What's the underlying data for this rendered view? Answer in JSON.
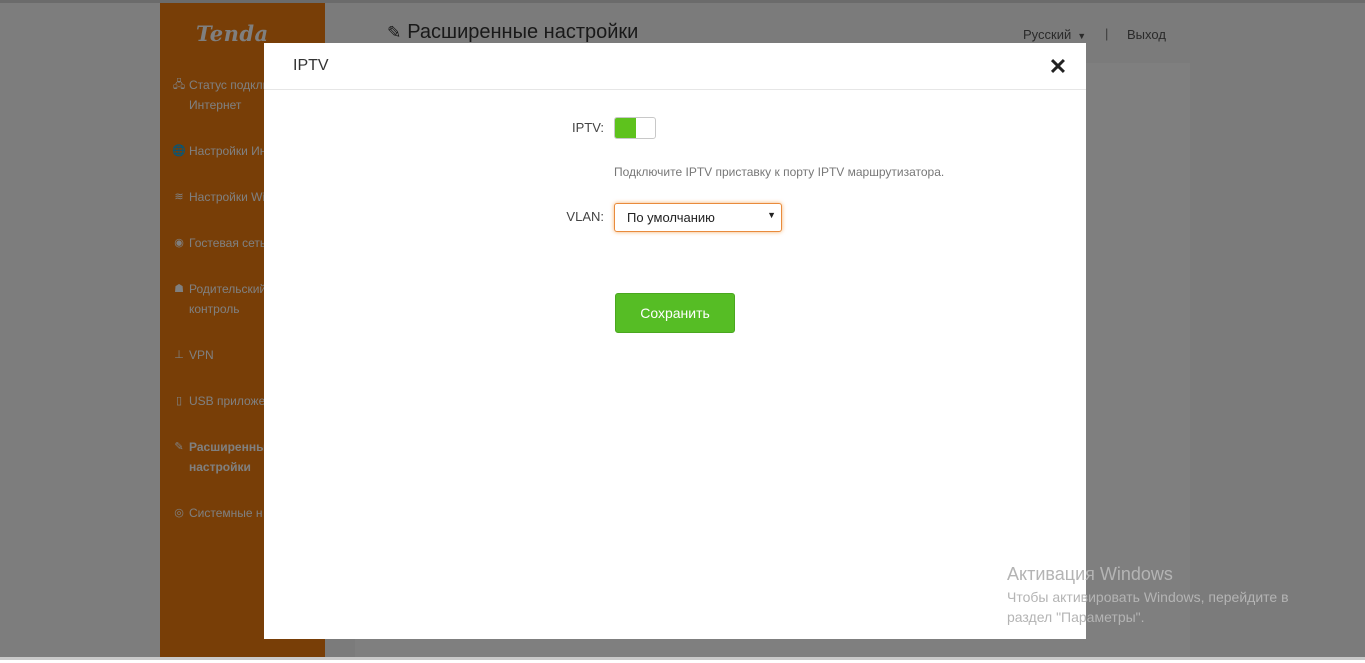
{
  "brand": {
    "logo": "Tenda",
    "accent": "#f07d0f"
  },
  "sidebar": {
    "items": [
      {
        "icon": "globe-plug-icon",
        "glyph": "🖧",
        "label": "Статус подклю",
        "label2": "Интернет"
      },
      {
        "icon": "globe-icon",
        "glyph": "🌐",
        "label": "Настройки Ин"
      },
      {
        "icon": "wifi-icon",
        "glyph": "≋",
        "label": "Настройки Wi"
      },
      {
        "icon": "guest-network-icon",
        "glyph": "◉",
        "label": "Гостевая сеть"
      },
      {
        "icon": "parental-control-icon",
        "glyph": "☗",
        "label": "Родительский",
        "label2": "контроль"
      },
      {
        "icon": "vpn-icon",
        "glyph": "⊥",
        "label": "VPN"
      },
      {
        "icon": "usb-icon",
        "glyph": "▯",
        "label": "USB приложе"
      },
      {
        "icon": "wrench-icon",
        "glyph": "✎",
        "label": "Расширенны",
        "label2": "настройки",
        "active": true
      },
      {
        "icon": "system-settings-icon",
        "glyph": "◎",
        "label": "Системные н"
      }
    ]
  },
  "header": {
    "title": "Расширенные настройки",
    "language": "Русский",
    "separator": "|",
    "logout": "Выход"
  },
  "modal": {
    "title": "IPTV",
    "close_glyph": "✕",
    "iptv_label": "IPTV:",
    "iptv_enabled": true,
    "hint": "Подключите IPTV приставку к порту IPTV маршрутизатора.",
    "vlan_label": "VLAN:",
    "vlan_value": "По умолчанию",
    "save_label": "Сохранить",
    "save_color": "#56bd25"
  },
  "watermark": {
    "title": "Активация Windows",
    "line1": "Чтобы активировать Windows, перейдите в",
    "line2": "раздел \"Параметры\"."
  }
}
